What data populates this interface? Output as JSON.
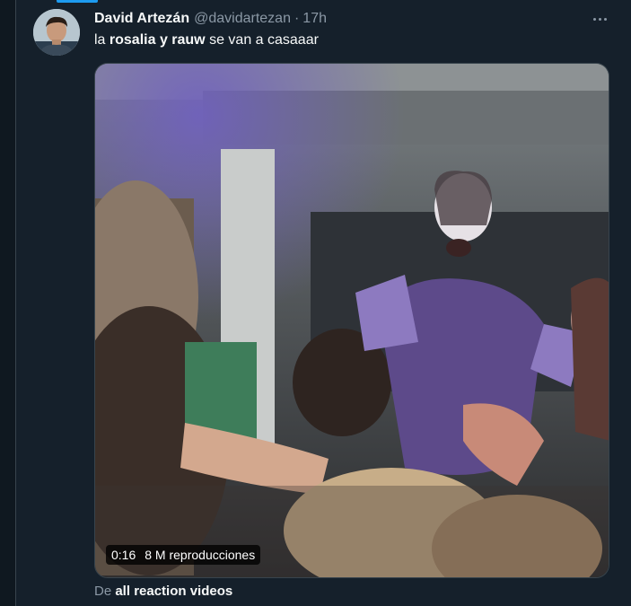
{
  "tweet": {
    "author_name": "David Artezán",
    "handle": "@davidartezan",
    "separator": "·",
    "time": "17h",
    "text_parts": [
      "la ",
      "rosalia y rauw",
      " se van a casaaar"
    ],
    "more_icon": "more-horizontal-icon"
  },
  "video": {
    "duration": "0:16",
    "views": "8 M reproducciones"
  },
  "source": {
    "prefix": "De ",
    "name": "all reaction videos"
  },
  "colors": {
    "background": "#15202b",
    "accent": "#1d9bf0",
    "secondary_text": "#8b98a5",
    "primary_text": "#f7f9f9"
  }
}
